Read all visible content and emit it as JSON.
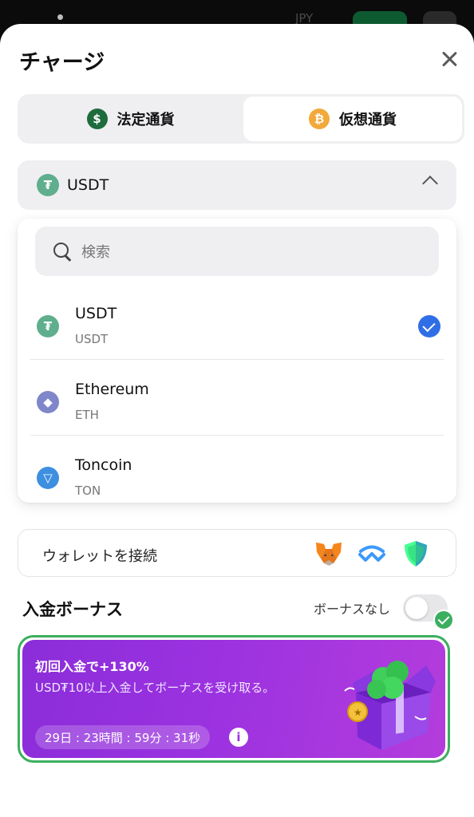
{
  "background": {
    "currency": "JPY",
    "accent_color": "#0f6e3a"
  },
  "sheet": {
    "title": "チャージ",
    "close_icon": "close-icon"
  },
  "tabs": [
    {
      "label": "法定通貨",
      "icon": "dollar-coin-icon",
      "selected": false
    },
    {
      "label": "仮想通貨",
      "icon": "bitcoin-coin-icon",
      "selected": true
    }
  ],
  "selector": {
    "selected": "USDT",
    "icon": "usdt-icon",
    "expanded": true
  },
  "dropdown": {
    "search_placeholder": "検索",
    "items": [
      {
        "name": "USDT",
        "code": "USDT",
        "icon": "usdt-icon",
        "selected": true
      },
      {
        "name": "Ethereum",
        "code": "ETH",
        "icon": "ethereum-icon",
        "selected": false
      },
      {
        "name": "Toncoin",
        "code": "TON",
        "icon": "toncoin-icon",
        "selected": false
      }
    ]
  },
  "wallet": {
    "label": "ウォレットを接続",
    "providers": [
      "metamask-icon",
      "walletconnect-icon",
      "trust-wallet-icon"
    ]
  },
  "bonus": {
    "title": "入金ボーナス",
    "no_bonus_label": "ボーナスなし",
    "no_bonus_enabled": false,
    "card": {
      "title": "初回入金で+130%",
      "subtitle": "USD₮10以上入金してボーナスを受け取る。",
      "timer": "29日 : 23時間 : 59分 : 31秒",
      "selected": true,
      "border_color": "#3cae60"
    }
  },
  "colors": {
    "primary_blue": "#2f6ee6",
    "purple": "#9b32e0",
    "usdt": "#5fae8e",
    "eth": "#7f86c9",
    "ton": "#3d8fe0"
  }
}
